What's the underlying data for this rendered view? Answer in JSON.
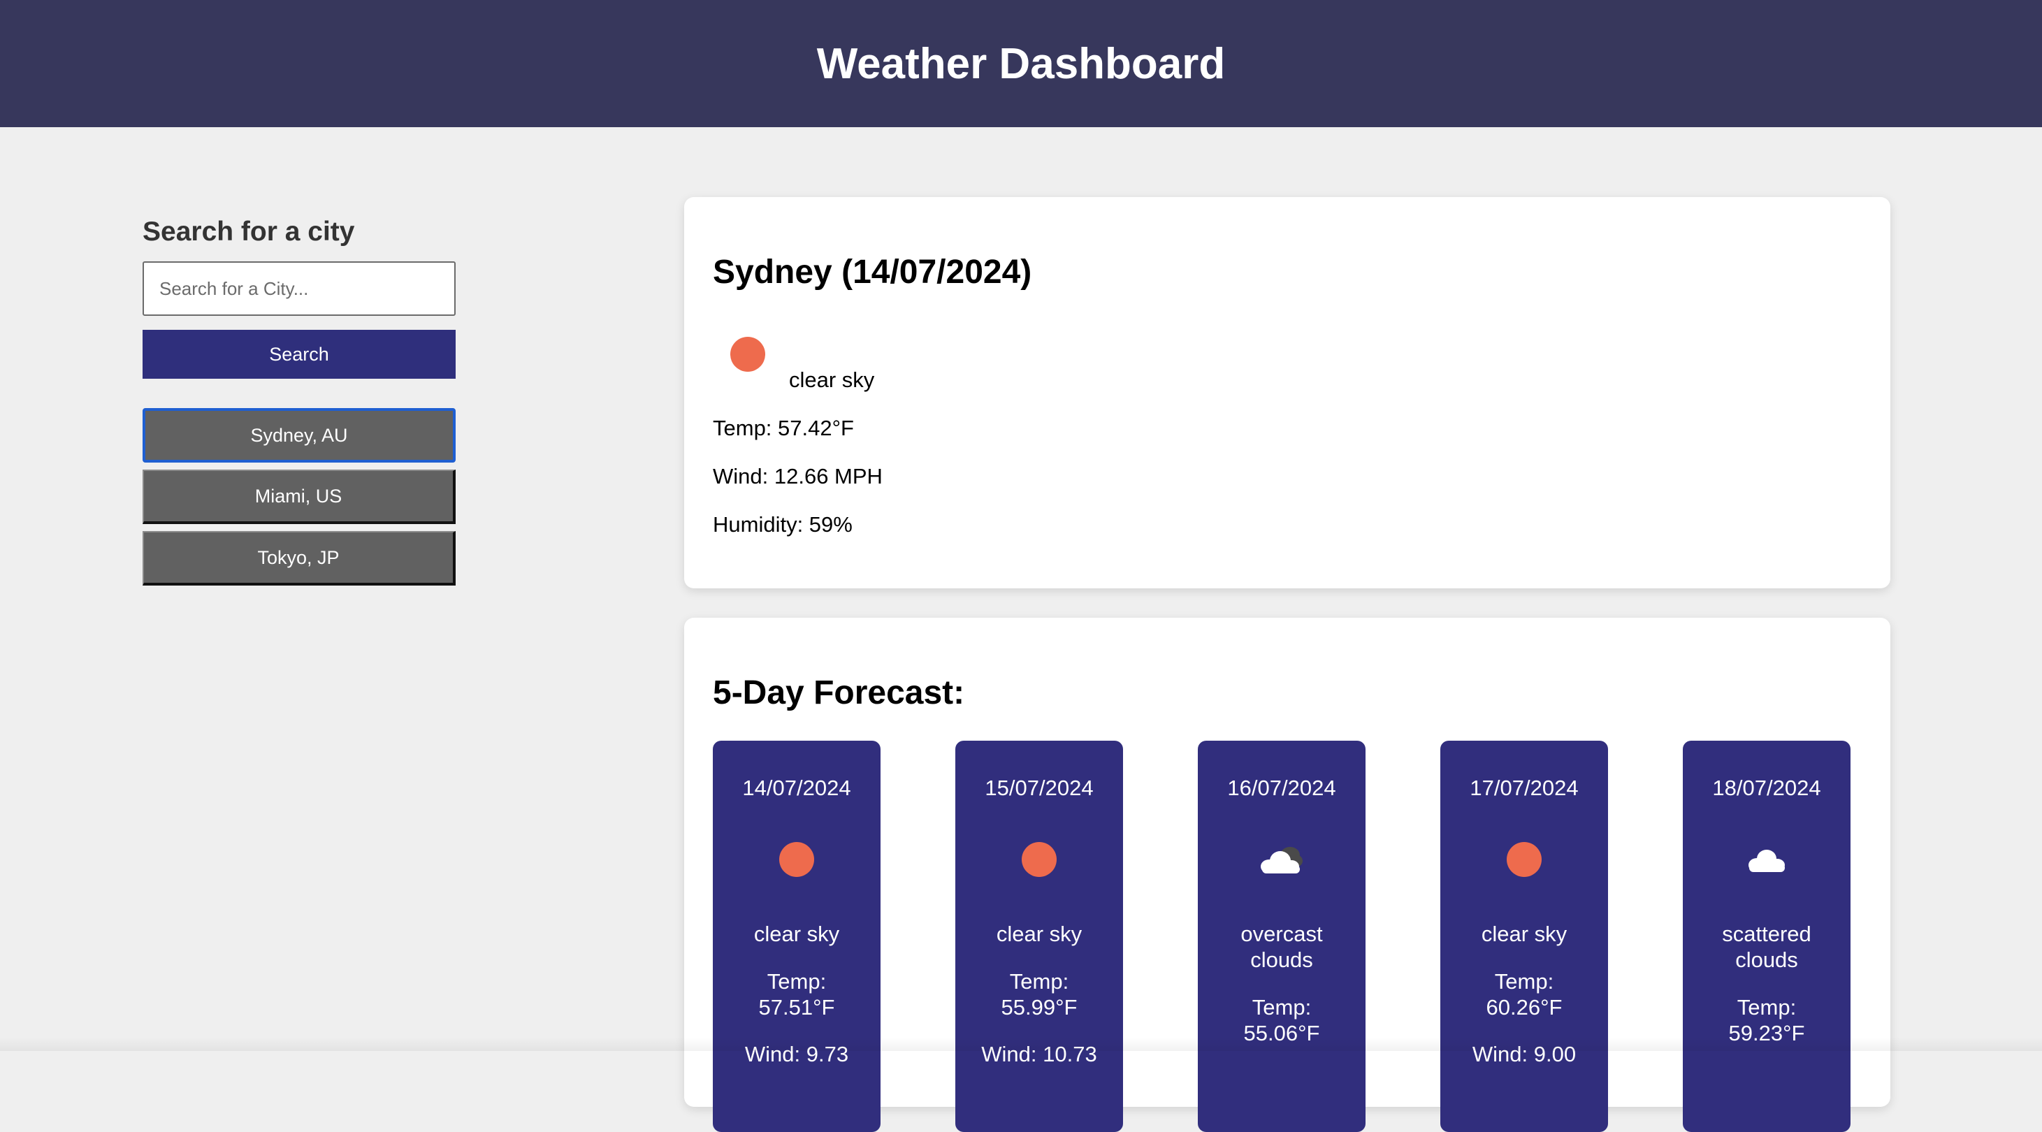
{
  "header": {
    "title": "Weather Dashboard"
  },
  "sidebar": {
    "heading": "Search for a city",
    "search_placeholder": "Search for a City...",
    "search_value": "",
    "search_button": "Search",
    "history": [
      {
        "label": "Sydney, AU",
        "active": true
      },
      {
        "label": "Miami, US",
        "active": false
      },
      {
        "label": "Tokyo, JP",
        "active": false
      }
    ]
  },
  "current": {
    "title": "Sydney (14/07/2024)",
    "icon": "sun-icon",
    "description": "clear sky",
    "temp": "Temp: 57.42°F",
    "wind": "Wind: 12.66 MPH",
    "humidity": "Humidity: 59%"
  },
  "forecast": {
    "title": "5-Day Forecast:",
    "days": [
      {
        "date": "14/07/2024",
        "icon": "sun-icon",
        "desc_lines": [
          "clear sky"
        ],
        "temp_label": "Temp:",
        "temp_value": "57.51°F",
        "wind": "Wind: 9.73"
      },
      {
        "date": "15/07/2024",
        "icon": "sun-icon",
        "desc_lines": [
          "clear sky"
        ],
        "temp_label": "Temp:",
        "temp_value": "55.99°F",
        "wind": "Wind: 10.73"
      },
      {
        "date": "16/07/2024",
        "icon": "overcast-clouds-icon",
        "desc_lines": [
          "overcast",
          "clouds"
        ],
        "temp_label": "Temp:",
        "temp_value": "55.06°F",
        "wind": ""
      },
      {
        "date": "17/07/2024",
        "icon": "sun-icon",
        "desc_lines": [
          "clear sky"
        ],
        "temp_label": "Temp:",
        "temp_value": "60.26°F",
        "wind": "Wind: 9.00"
      },
      {
        "date": "18/07/2024",
        "icon": "scattered-clouds-icon",
        "desc_lines": [
          "scattered",
          "clouds"
        ],
        "temp_label": "Temp:",
        "temp_value": "59.23°F",
        "wind": ""
      }
    ]
  },
  "colors": {
    "header_bg": "#37375c",
    "accent": "#2f2f7c",
    "forecast_card": "#312e7d",
    "sun": "#ee6b4d",
    "history_button": "#616161",
    "active_outline": "#1f5fd1"
  }
}
